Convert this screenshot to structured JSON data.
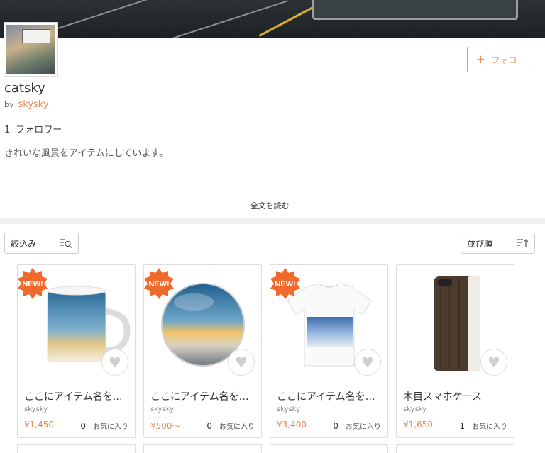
{
  "header": {
    "follow_label": "フォロー"
  },
  "shop": {
    "name": "catsky",
    "by": "by",
    "owner": "skysky",
    "follower_count": "1",
    "follower_label": "フォロワー",
    "description": "きれいな風景をアイテムにしています。",
    "read_more": "全文を読む"
  },
  "toolbar": {
    "filter_label": "絞込み",
    "sort_label": "並び順"
  },
  "products": [
    {
      "name": "ここにアイテム名を…",
      "seller": "skysky",
      "price": "¥1,450",
      "likes": "0",
      "likes_label": "お気に入り",
      "badge": "NEW!"
    },
    {
      "name": "ここにアイテム名を…",
      "seller": "skysky",
      "price": "¥500〜",
      "likes": "0",
      "likes_label": "お気に入り",
      "badge": "NEW!"
    },
    {
      "name": "ここにアイテム名を…",
      "seller": "skysky",
      "price": "¥3,400",
      "likes": "0",
      "likes_label": "お気に入り",
      "badge": "NEW!"
    },
    {
      "name": "木目スマホケース",
      "seller": "skysky",
      "price": "¥1,650",
      "likes": "1",
      "likes_label": "お気に入り",
      "badge": ""
    }
  ],
  "colors": {
    "accent": "#e88a55",
    "badge": "#ef6a2c"
  }
}
